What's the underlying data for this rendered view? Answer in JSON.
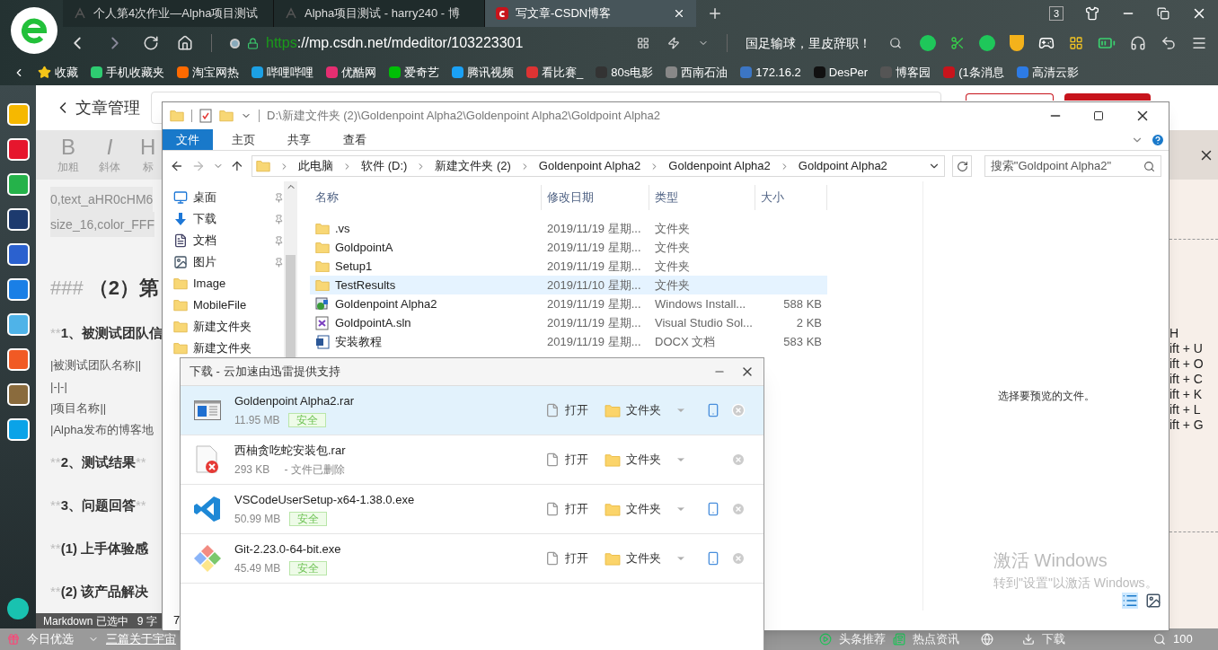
{
  "browser": {
    "tabs": [
      {
        "title": "个人第4次作业—Alpha项目测试",
        "selected": false
      },
      {
        "title": "Alpha项目测试 - harry240 - 博",
        "selected": false
      },
      {
        "title": "写文章-CSDN博客",
        "selected": true
      }
    ],
    "tab_count": "3",
    "address": {
      "scheme": "https",
      "rest": "://mp.csdn.net/mdeditor/103223301"
    },
    "news": "国足输球，里皮辞职！",
    "bookmarks": [
      "收藏",
      "手机收藏夹",
      "淘宝网热",
      "哔哩哔哩",
      "优酷网",
      "爱奇艺",
      "腾讯视频",
      "看比赛_",
      "80s电影",
      "西南石油",
      "172.16.2",
      "DesPer",
      "博客园",
      "(1条消息",
      "高清云影"
    ]
  },
  "editor": {
    "back": "文章管理",
    "tools": [
      {
        "glyph": "B",
        "label": "加粗"
      },
      {
        "glyph": "I",
        "label": "斜体"
      },
      {
        "glyph": "H",
        "label": "标"
      }
    ],
    "lines": [
      {
        "kind": "code",
        "text": "0,text_aHR0cHM6"
      },
      {
        "kind": "code",
        "text": "size_16,color_FFF"
      },
      {
        "kind": "heading",
        "marker": "###",
        "text": "（2）第"
      },
      {
        "kind": "bold",
        "marker": "**",
        "text": "1、被测试团队信"
      },
      {
        "kind": "plain",
        "text": "|被测试团队名称||"
      },
      {
        "kind": "plain",
        "text": "|-|-|"
      },
      {
        "kind": "plain",
        "text": "|项目名称||"
      },
      {
        "kind": "plain",
        "text": "|Alpha发布的博客地"
      },
      {
        "kind": "bold",
        "marker": "**",
        "text": "2、测试结果",
        "end": "**"
      },
      {
        "kind": "bold",
        "marker": "**",
        "text": "3、问题回答",
        "end": "**"
      },
      {
        "kind": "bold",
        "marker": "**",
        "text": "(1)   上手体验感"
      },
      {
        "kind": "bold",
        "marker": "**",
        "text": "(2)   该产品解决"
      }
    ],
    "status": "Markdown 已选中   9 字",
    "shortcuts": [
      "H",
      "ift + U",
      "ift + O",
      "ift + C",
      "ift + K",
      "ift + L",
      "ift + G"
    ]
  },
  "explorer": {
    "title": "D:\\新建文件夹 (2)\\Goldenpoint Alpha2\\Goldenpoint Alpha2\\Goldpoint Alpha2",
    "ribbon_tabs": [
      {
        "label": "文件",
        "selected": true
      },
      {
        "label": "主页",
        "selected": false
      },
      {
        "label": "共享",
        "selected": false
      },
      {
        "label": "查看",
        "selected": false
      }
    ],
    "breadcrumbs": [
      "此电脑",
      "软件 (D:)",
      "新建文件夹 (2)",
      "Goldenpoint Alpha2",
      "Goldenpoint Alpha2",
      "Goldpoint Alpha2"
    ],
    "search_placeholder": "搜索\"Goldpoint Alpha2\"",
    "nav": [
      {
        "label": "桌面",
        "kind": "desktop",
        "pinned": true
      },
      {
        "label": "下载",
        "kind": "download",
        "pinned": true
      },
      {
        "label": "文档",
        "kind": "document",
        "pinned": true
      },
      {
        "label": "图片",
        "kind": "pictures",
        "pinned": true
      },
      {
        "label": "Image",
        "kind": "folder",
        "pinned": false
      },
      {
        "label": "MobileFile",
        "kind": "folder",
        "pinned": false
      },
      {
        "label": "新建文件夹",
        "kind": "folder",
        "pinned": false
      },
      {
        "label": "新建文件夹",
        "kind": "folder",
        "pinned": false
      }
    ],
    "columns": [
      "名称",
      "修改日期",
      "类型",
      "大小"
    ],
    "rows": [
      {
        "name": ".vs",
        "date": "2019/11/19 星期...",
        "type": "文件夹",
        "kind": "folder",
        "selected": false
      },
      {
        "name": "GoldpointA",
        "date": "2019/11/19 星期...",
        "type": "文件夹",
        "kind": "folder",
        "selected": false
      },
      {
        "name": "Setup1",
        "date": "2019/11/19 星期...",
        "type": "文件夹",
        "kind": "folder",
        "selected": false
      },
      {
        "name": "TestResults",
        "date": "2019/11/10 星期...",
        "type": "文件夹",
        "kind": "folder",
        "selected": true
      },
      {
        "name": "Goldenpoint Alpha2",
        "date": "2019/11/19 星期...",
        "type": "Windows Install...",
        "size": "588 KB",
        "kind": "installer",
        "selected": false
      },
      {
        "name": "GoldpointA.sln",
        "date": "2019/11/19 星期...",
        "type": "Visual Studio Sol...",
        "size": "2 KB",
        "kind": "solution",
        "selected": false
      },
      {
        "name": "安装教程",
        "date": "2019/11/19 星期...",
        "type": "DOCX 文档",
        "size": "583 KB",
        "kind": "word",
        "selected": false
      }
    ],
    "preview": "选择要预览的文件。",
    "status": "7",
    "activation": {
      "title": "激活 Windows",
      "hint": "转到\"设置\"以激活 Windows。"
    }
  },
  "downloads": {
    "title": "下载 - 云加速由迅雷提供支持",
    "items": [
      {
        "name": "Goldenpoint Alpha2.rar",
        "size": "11.95 MB",
        "kind": "archive",
        "badge": "安全",
        "selected": true,
        "phone": true,
        "open": "打开",
        "folder": "文件夹"
      },
      {
        "name": "西柚贪吃蛇安装包.rar",
        "size": "293 KB",
        "kind": "deleted",
        "note": "- 文件已删除",
        "selected": false,
        "phone": false,
        "open": "打开",
        "folder": "文件夹"
      },
      {
        "name": "VSCodeUserSetup-x64-1.38.0.exe",
        "size": "50.99 MB",
        "kind": "vscode",
        "badge": "安全",
        "selected": false,
        "phone": true,
        "open": "打开",
        "folder": "文件夹"
      },
      {
        "name": "Git-2.23.0-64-bit.exe",
        "size": "45.49 MB",
        "kind": "git",
        "badge": "安全",
        "selected": false,
        "phone": true,
        "open": "打开",
        "folder": "文件夹"
      }
    ]
  },
  "taskbar": {
    "left": [
      "今日优选",
      "三篇关于宇宙"
    ],
    "right": [
      "头条推荐",
      "热点资讯"
    ],
    "download": "下载",
    "zoom": "100"
  }
}
